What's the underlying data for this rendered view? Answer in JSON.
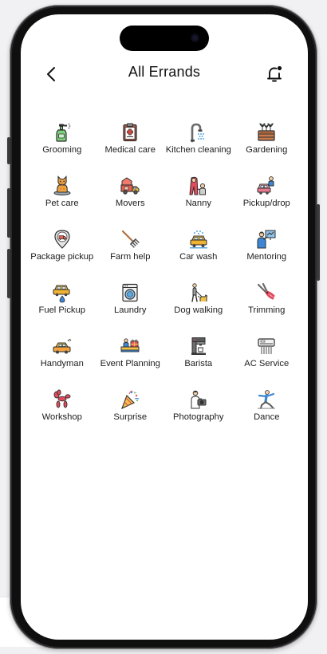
{
  "header": {
    "title": "All Errands"
  },
  "errands": [
    {
      "label": "Grooming",
      "icon": "spray-bottle-icon"
    },
    {
      "label": "Medical care",
      "icon": "clipboard-medical-icon"
    },
    {
      "label": "Kitchen cleaning",
      "icon": "faucet-icon"
    },
    {
      "label": "Gardening",
      "icon": "plant-box-icon"
    },
    {
      "label": "Pet care",
      "icon": "cat-icon"
    },
    {
      "label": "Movers",
      "icon": "moving-truck-icon"
    },
    {
      "label": "Nanny",
      "icon": "nanny-child-icon"
    },
    {
      "label": "Pickup/drop",
      "icon": "person-car-icon"
    },
    {
      "label": "Package pickup",
      "icon": "package-location-icon"
    },
    {
      "label": "Farm help",
      "icon": "rake-icon"
    },
    {
      "label": "Car wash",
      "icon": "car-wash-icon"
    },
    {
      "label": "Mentoring",
      "icon": "mentor-board-icon"
    },
    {
      "label": "Fuel Pickup",
      "icon": "fuel-car-icon"
    },
    {
      "label": "Laundry",
      "icon": "washing-machine-icon"
    },
    {
      "label": "Dog walking",
      "icon": "dog-walker-icon"
    },
    {
      "label": "Trimming",
      "icon": "shears-icon"
    },
    {
      "label": "Handyman",
      "icon": "service-car-icon"
    },
    {
      "label": "Event Planning",
      "icon": "event-gift-icon"
    },
    {
      "label": "Barista",
      "icon": "coffee-machine-icon"
    },
    {
      "label": "AC Service",
      "icon": "air-conditioner-icon"
    },
    {
      "label": "Workshop",
      "icon": "balloon-dog-icon"
    },
    {
      "label": "Surprise",
      "icon": "party-popper-icon"
    },
    {
      "label": "Photography",
      "icon": "photographer-icon"
    },
    {
      "label": "Dance",
      "icon": "dancer-icon"
    }
  ]
}
